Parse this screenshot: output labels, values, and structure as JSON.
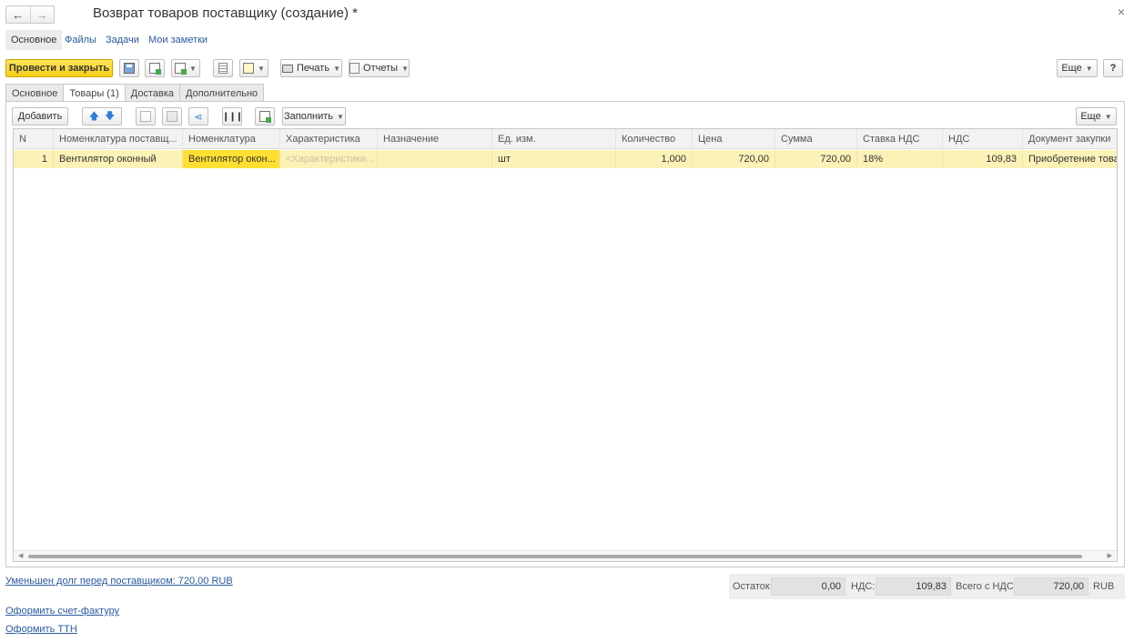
{
  "window": {
    "title": "Возврат товаров поставщику (создание) *",
    "back_icon": "arrow-left-icon",
    "forward_icon": "arrow-right-icon",
    "close_icon": "close-icon"
  },
  "sections": {
    "main": "Основное",
    "files": "Файлы",
    "tasks": "Задачи",
    "notes": "Мои заметки"
  },
  "toolbar": {
    "post_close": "Провести и закрыть",
    "print": "Печать",
    "reports": "Отчеты",
    "more": "Еще",
    "help": "?"
  },
  "tabs": [
    "Основное",
    "Товары (1)",
    "Доставка",
    "Дополнительно"
  ],
  "table_toolbar": {
    "add": "Добавить",
    "fill": "Заполнить",
    "more": "Еще"
  },
  "table": {
    "columns": [
      "N",
      "Номенклатура поставщ...",
      "Номенклатура",
      "Характеристика",
      "Назначение",
      "Ед. изм.",
      "Количество",
      "Цена",
      "Сумма",
      "Ставка НДС",
      "НДС",
      "Документ закупки"
    ],
    "rows": [
      [
        "1",
        "Вентилятор оконный",
        "Вентилятор окон...",
        "<Характеристики...",
        "",
        "шт",
        "1,000",
        "720,00",
        "720,00",
        "18%",
        "109,83",
        "Приобретение товар"
      ]
    ]
  },
  "footer": {
    "debt_link": "Уменьшен долг перед поставщиком: 720,00 RUB",
    "invoice_link": "Оформить счет-фактуру",
    "ttn_link": "Оформить ТТН",
    "remainder_label": "Остаток:",
    "remainder_value": "0,00",
    "vat_label": "НДС:",
    "vat_value": "109,83",
    "total_label": "Всего с НДС:",
    "total_value": "720,00",
    "currency": "RUB"
  },
  "colors": {
    "accent_yellow": "#f5cf18",
    "selected_row": "#fbf2b8",
    "selected_cell": "#ffe032",
    "link": "#2a5aa0"
  }
}
